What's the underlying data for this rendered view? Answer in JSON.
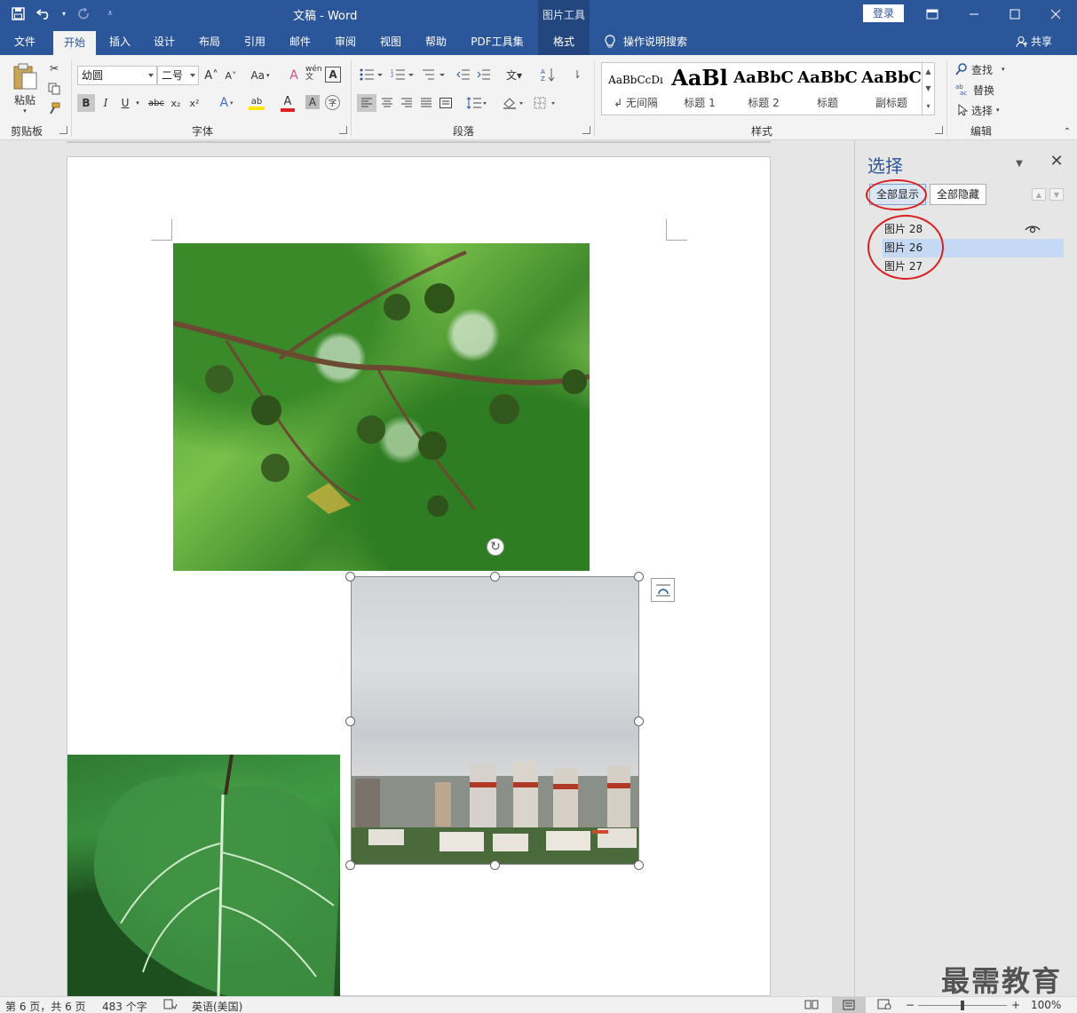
{
  "titlebar": {
    "doc_title": "文稿  -  Word",
    "context_tool": "图片工具",
    "login": "登录"
  },
  "tabs": [
    {
      "label": "文件"
    },
    {
      "label": "开始"
    },
    {
      "label": "插入"
    },
    {
      "label": "设计"
    },
    {
      "label": "布局"
    },
    {
      "label": "引用"
    },
    {
      "label": "邮件"
    },
    {
      "label": "审阅"
    },
    {
      "label": "视图"
    },
    {
      "label": "帮助"
    },
    {
      "label": "PDF工具集"
    },
    {
      "label": "格式"
    }
  ],
  "tellme": "操作说明搜索",
  "share": "共享",
  "ribbon": {
    "clipboard": {
      "paste": "粘贴",
      "label": "剪贴板"
    },
    "font": {
      "name": "幼圆",
      "size": "二号",
      "label": "字体",
      "bold": "B",
      "italic": "I",
      "underline": "U",
      "strike": "abc",
      "sub": "x₂",
      "sup": "x²",
      "grow": "A˄",
      "shrink": "A˅",
      "case": "Aa",
      "clear": "A",
      "phonetic": "wén文",
      "border": "A",
      "effects": "A",
      "highlight": "ab",
      "color": "A",
      "shade": "A",
      "enclose": "字"
    },
    "paragraph": {
      "label": "段落"
    },
    "styles": {
      "label": "样式",
      "items": [
        {
          "sample": "AaBbCcDı",
          "name": "↲ 无间隔"
        },
        {
          "sample": "AaBl",
          "name": "标题 1"
        },
        {
          "sample": "AaBbC",
          "name": "标题 2"
        },
        {
          "sample": "AaBbC",
          "name": "标题"
        },
        {
          "sample": "AaBbC",
          "name": "副标题"
        }
      ]
    },
    "editing": {
      "label": "编辑",
      "find": "查找",
      "replace": "替换",
      "select": "选择"
    }
  },
  "selection_pane": {
    "title": "选择",
    "show_all": "全部显示",
    "hide_all": "全部隐藏",
    "shapes": [
      {
        "name": "图片 28",
        "selected": false
      },
      {
        "name": "图片 26",
        "selected": true
      },
      {
        "name": "图片 27",
        "selected": false
      }
    ]
  },
  "status": {
    "page": "第 6 页，共 6 页",
    "words": "483 个字",
    "language": "英语(美国)",
    "zoom": "100%"
  },
  "watermark": "最需教育",
  "colors": {
    "brand": "#2b579a",
    "annotation": "#d92020",
    "selected_row": "#c5d9f5"
  }
}
